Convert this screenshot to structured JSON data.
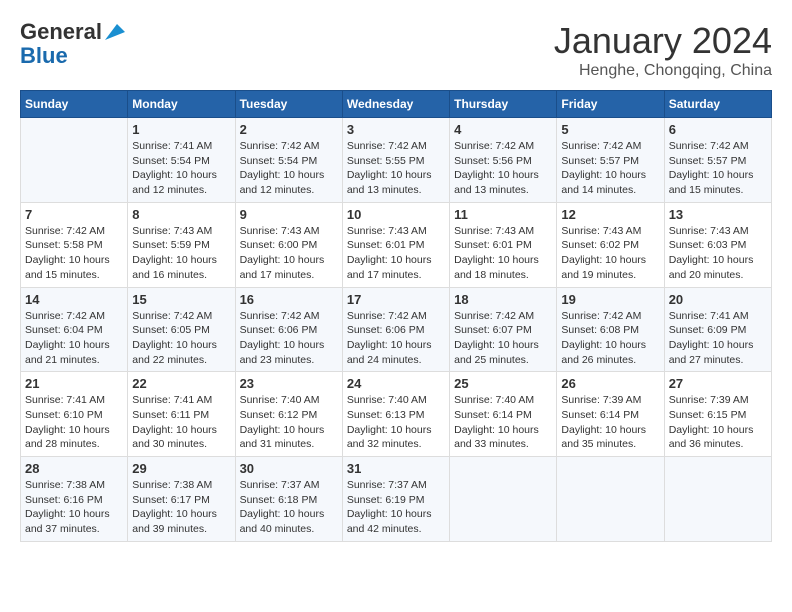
{
  "header": {
    "logo_line1": "General",
    "logo_line2": "Blue",
    "month_year": "January 2024",
    "location": "Henghe, Chongqing, China"
  },
  "days_of_week": [
    "Sunday",
    "Monday",
    "Tuesday",
    "Wednesday",
    "Thursday",
    "Friday",
    "Saturday"
  ],
  "weeks": [
    [
      {
        "day": "",
        "info": ""
      },
      {
        "day": "1",
        "info": "Sunrise: 7:41 AM\nSunset: 5:54 PM\nDaylight: 10 hours\nand 12 minutes."
      },
      {
        "day": "2",
        "info": "Sunrise: 7:42 AM\nSunset: 5:54 PM\nDaylight: 10 hours\nand 12 minutes."
      },
      {
        "day": "3",
        "info": "Sunrise: 7:42 AM\nSunset: 5:55 PM\nDaylight: 10 hours\nand 13 minutes."
      },
      {
        "day": "4",
        "info": "Sunrise: 7:42 AM\nSunset: 5:56 PM\nDaylight: 10 hours\nand 13 minutes."
      },
      {
        "day": "5",
        "info": "Sunrise: 7:42 AM\nSunset: 5:57 PM\nDaylight: 10 hours\nand 14 minutes."
      },
      {
        "day": "6",
        "info": "Sunrise: 7:42 AM\nSunset: 5:57 PM\nDaylight: 10 hours\nand 15 minutes."
      }
    ],
    [
      {
        "day": "7",
        "info": "Sunrise: 7:42 AM\nSunset: 5:58 PM\nDaylight: 10 hours\nand 15 minutes."
      },
      {
        "day": "8",
        "info": "Sunrise: 7:43 AM\nSunset: 5:59 PM\nDaylight: 10 hours\nand 16 minutes."
      },
      {
        "day": "9",
        "info": "Sunrise: 7:43 AM\nSunset: 6:00 PM\nDaylight: 10 hours\nand 17 minutes."
      },
      {
        "day": "10",
        "info": "Sunrise: 7:43 AM\nSunset: 6:01 PM\nDaylight: 10 hours\nand 17 minutes."
      },
      {
        "day": "11",
        "info": "Sunrise: 7:43 AM\nSunset: 6:01 PM\nDaylight: 10 hours\nand 18 minutes."
      },
      {
        "day": "12",
        "info": "Sunrise: 7:43 AM\nSunset: 6:02 PM\nDaylight: 10 hours\nand 19 minutes."
      },
      {
        "day": "13",
        "info": "Sunrise: 7:43 AM\nSunset: 6:03 PM\nDaylight: 10 hours\nand 20 minutes."
      }
    ],
    [
      {
        "day": "14",
        "info": "Sunrise: 7:42 AM\nSunset: 6:04 PM\nDaylight: 10 hours\nand 21 minutes."
      },
      {
        "day": "15",
        "info": "Sunrise: 7:42 AM\nSunset: 6:05 PM\nDaylight: 10 hours\nand 22 minutes."
      },
      {
        "day": "16",
        "info": "Sunrise: 7:42 AM\nSunset: 6:06 PM\nDaylight: 10 hours\nand 23 minutes."
      },
      {
        "day": "17",
        "info": "Sunrise: 7:42 AM\nSunset: 6:06 PM\nDaylight: 10 hours\nand 24 minutes."
      },
      {
        "day": "18",
        "info": "Sunrise: 7:42 AM\nSunset: 6:07 PM\nDaylight: 10 hours\nand 25 minutes."
      },
      {
        "day": "19",
        "info": "Sunrise: 7:42 AM\nSunset: 6:08 PM\nDaylight: 10 hours\nand 26 minutes."
      },
      {
        "day": "20",
        "info": "Sunrise: 7:41 AM\nSunset: 6:09 PM\nDaylight: 10 hours\nand 27 minutes."
      }
    ],
    [
      {
        "day": "21",
        "info": "Sunrise: 7:41 AM\nSunset: 6:10 PM\nDaylight: 10 hours\nand 28 minutes."
      },
      {
        "day": "22",
        "info": "Sunrise: 7:41 AM\nSunset: 6:11 PM\nDaylight: 10 hours\nand 30 minutes."
      },
      {
        "day": "23",
        "info": "Sunrise: 7:40 AM\nSunset: 6:12 PM\nDaylight: 10 hours\nand 31 minutes."
      },
      {
        "day": "24",
        "info": "Sunrise: 7:40 AM\nSunset: 6:13 PM\nDaylight: 10 hours\nand 32 minutes."
      },
      {
        "day": "25",
        "info": "Sunrise: 7:40 AM\nSunset: 6:14 PM\nDaylight: 10 hours\nand 33 minutes."
      },
      {
        "day": "26",
        "info": "Sunrise: 7:39 AM\nSunset: 6:14 PM\nDaylight: 10 hours\nand 35 minutes."
      },
      {
        "day": "27",
        "info": "Sunrise: 7:39 AM\nSunset: 6:15 PM\nDaylight: 10 hours\nand 36 minutes."
      }
    ],
    [
      {
        "day": "28",
        "info": "Sunrise: 7:38 AM\nSunset: 6:16 PM\nDaylight: 10 hours\nand 37 minutes."
      },
      {
        "day": "29",
        "info": "Sunrise: 7:38 AM\nSunset: 6:17 PM\nDaylight: 10 hours\nand 39 minutes."
      },
      {
        "day": "30",
        "info": "Sunrise: 7:37 AM\nSunset: 6:18 PM\nDaylight: 10 hours\nand 40 minutes."
      },
      {
        "day": "31",
        "info": "Sunrise: 7:37 AM\nSunset: 6:19 PM\nDaylight: 10 hours\nand 42 minutes."
      },
      {
        "day": "",
        "info": ""
      },
      {
        "day": "",
        "info": ""
      },
      {
        "day": "",
        "info": ""
      }
    ]
  ]
}
